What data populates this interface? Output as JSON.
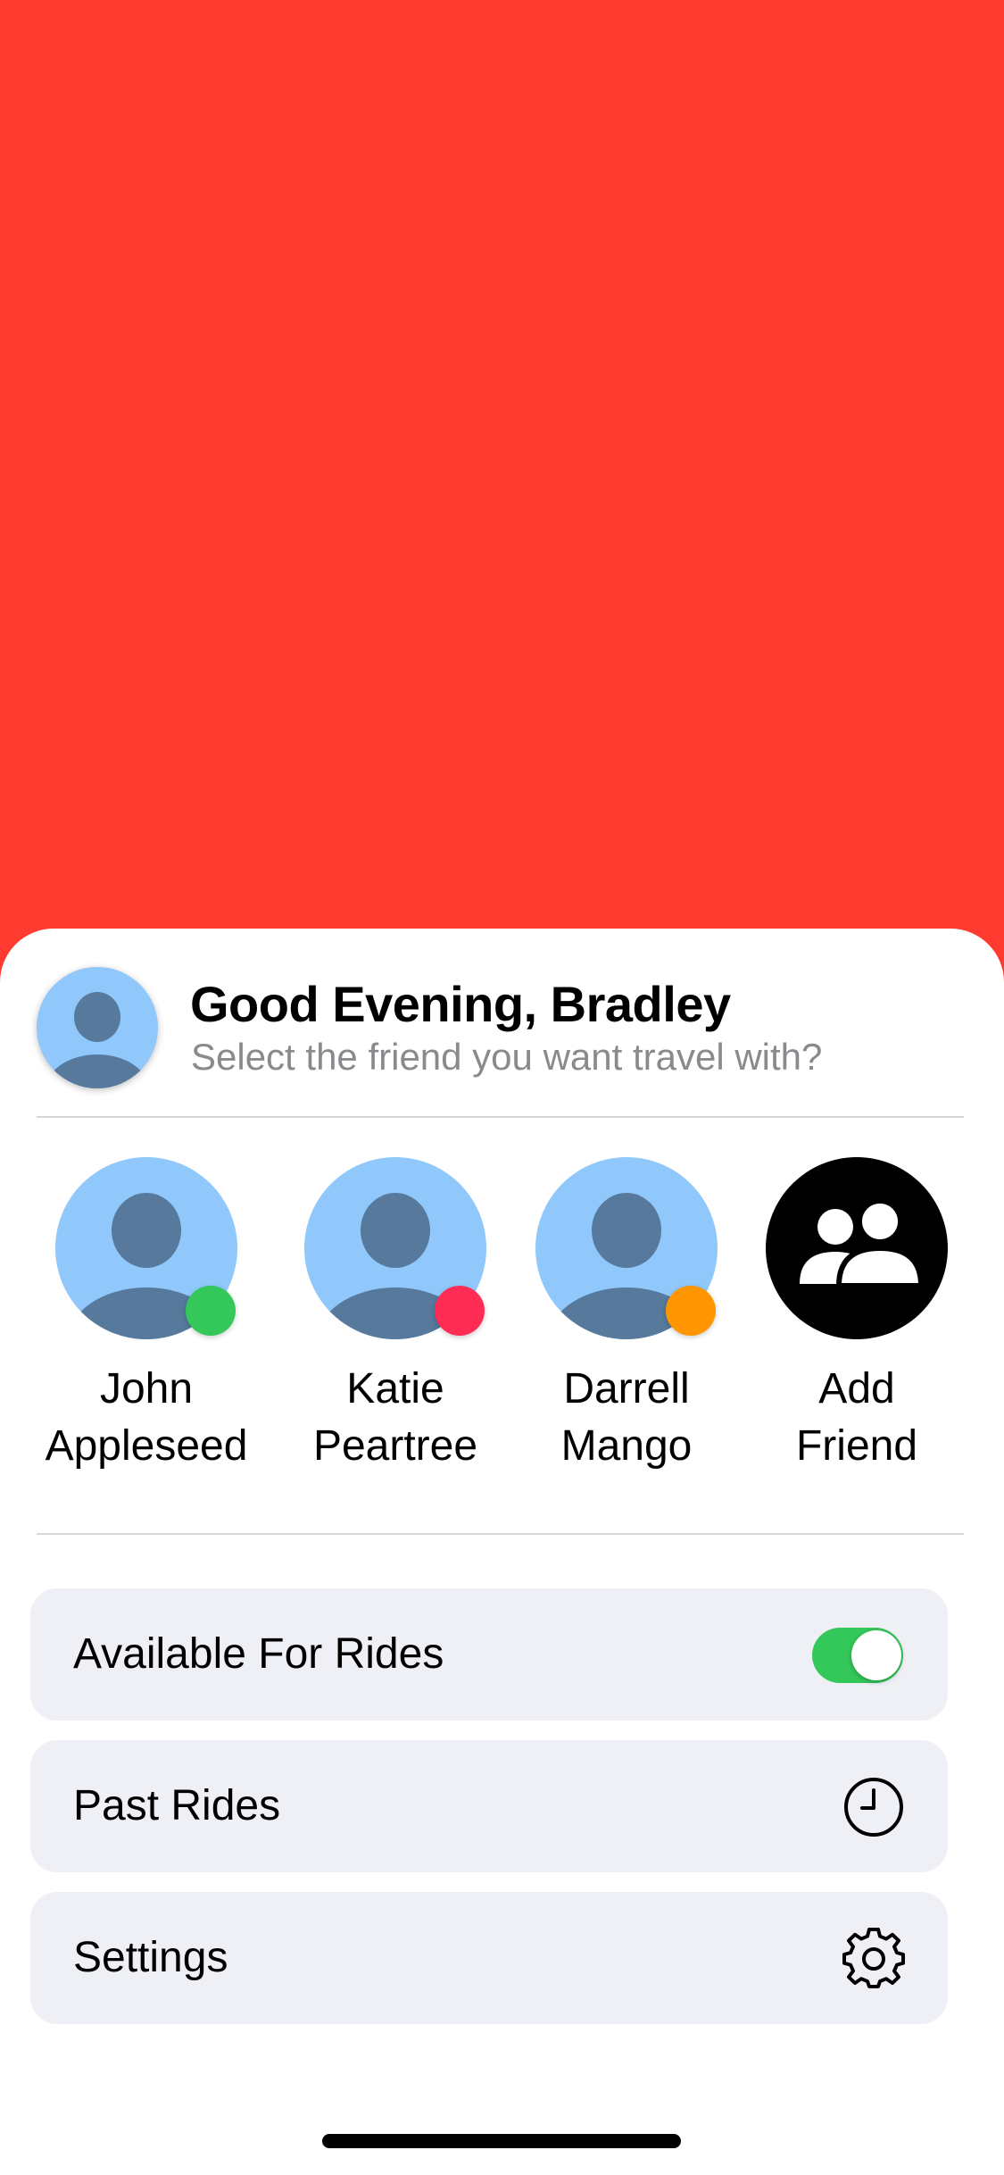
{
  "header": {
    "greeting": "Good Evening, Bradley",
    "subtitle": "Select the friend you want travel with?",
    "avatar_icon": "person-icon"
  },
  "friends": [
    {
      "name_line1": "John",
      "name_line2": "Appleseed",
      "status_color": "#34c759"
    },
    {
      "name_line1": "Katie",
      "name_line2": "Peartree",
      "status_color": "#ff2d55"
    },
    {
      "name_line1": "Darrell",
      "name_line2": "Mango",
      "status_color": "#ff9500"
    }
  ],
  "add_friend": {
    "name_line1": "Add",
    "name_line2": "Friend",
    "icon": "people-icon"
  },
  "menu": {
    "available": {
      "label": "Available For Rides",
      "toggle_on": true
    },
    "past_rides": {
      "label": "Past Rides",
      "icon": "clock-icon"
    },
    "settings": {
      "label": "Settings",
      "icon": "gear-icon"
    }
  },
  "colors": {
    "background": "#ff3b30",
    "avatar_bg": "#90c8fb",
    "avatar_figure": "#56799c",
    "toggle_on": "#34c759",
    "row_bg": "#eff0f5"
  }
}
